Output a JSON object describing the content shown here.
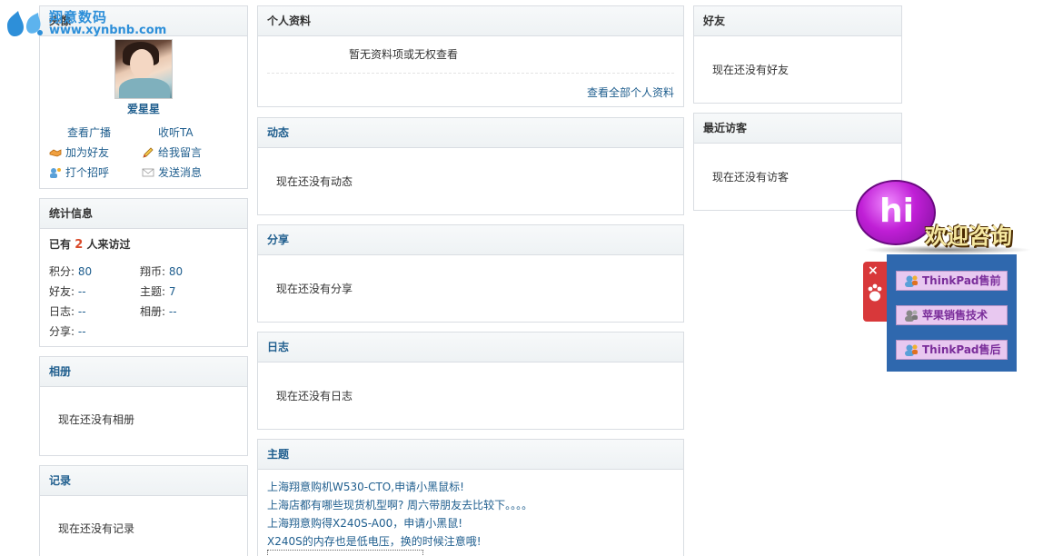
{
  "logo": {
    "cn": "翔意数码",
    "en": "www.xynbnb.com"
  },
  "avatar_panel": {
    "title": "头像",
    "username": "爱星星",
    "actions": {
      "view_broadcast": "查看广播",
      "follow": "收听TA",
      "add_friend": "加为好友",
      "leave_message": "给我留言",
      "greet": "打个招呼",
      "send_message": "发送消息"
    }
  },
  "stats_panel": {
    "title": "统计信息",
    "visited_prefix": "已有",
    "visited_count": "2",
    "visited_suffix": "人来访过",
    "items": [
      {
        "label": "积分: ",
        "value": "80"
      },
      {
        "label": "翔币: ",
        "value": "80"
      },
      {
        "label": "好友: ",
        "value": "--"
      },
      {
        "label": "主题: ",
        "value": "7"
      },
      {
        "label": "日志: ",
        "value": "--"
      },
      {
        "label": "相册: ",
        "value": "--"
      },
      {
        "label": "分享: ",
        "value": "--"
      }
    ]
  },
  "album_panel": {
    "title": "相册",
    "empty": "现在还没有相册"
  },
  "record_panel": {
    "title": "记录",
    "empty": "现在还没有记录"
  },
  "profile_panel": {
    "title": "个人资料",
    "empty": "暂无资料项或无权查看",
    "view_all": "查看全部个人资料"
  },
  "feed_panel": {
    "title": "动态",
    "empty": "现在还没有动态"
  },
  "share_panel": {
    "title": "分享",
    "empty": "现在还没有分享"
  },
  "blog_panel": {
    "title": "日志",
    "empty": "现在还没有日志"
  },
  "topics_panel": {
    "title": "主题",
    "items": [
      "上海翔意购机W530-CTO,申请小黑鼠标!",
      "上海店都有哪些现货机型啊? 周六带朋友去比较下。。。。",
      "上海翔意购得X240S-A00，申请小黑鼠!",
      "X240S的内存也是低电压，换的时候注意哦!"
    ]
  },
  "friends_panel": {
    "title": "好友",
    "empty": "现在还没有好友"
  },
  "visitors_panel": {
    "title": "最近访客",
    "empty": "现在还没有访客"
  },
  "chat_widget": {
    "hi": "hi",
    "welcome": "欢迎咨询",
    "close": "×",
    "items": [
      "ThinkPad售前",
      "苹果销售技术",
      "ThinkPad售后"
    ]
  },
  "colors": {
    "link": "#1f5e8e",
    "accent_red": "#d94a2a",
    "widget_blue": "#2f68ae",
    "widget_item": "#e8c8f0"
  }
}
